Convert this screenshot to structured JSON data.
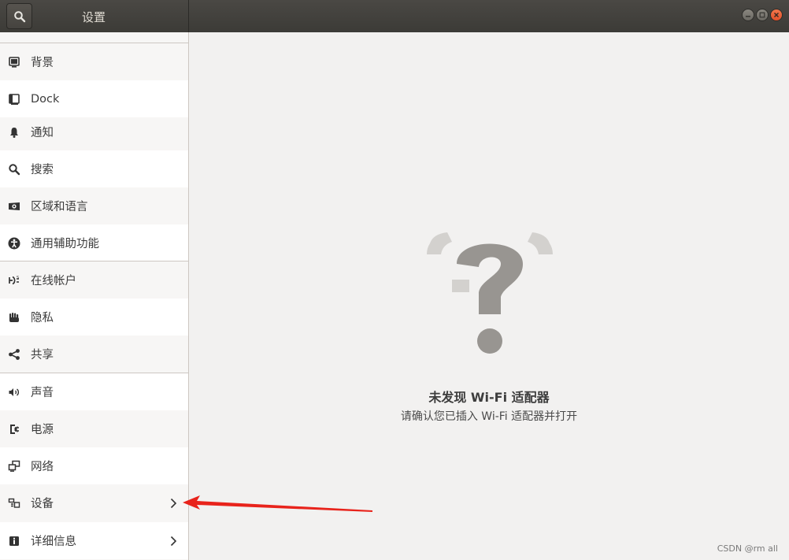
{
  "window": {
    "title": "设置",
    "search_icon": "search-icon",
    "controls": [
      "minimize-icon",
      "maximize-icon",
      "close-icon"
    ]
  },
  "sidebar": {
    "items": [
      {
        "label": "背景",
        "icon": "background-icon"
      },
      {
        "label": "Dock",
        "icon": "dock-icon"
      },
      {
        "label": "通知",
        "icon": "bell-icon"
      },
      {
        "label": "搜索",
        "icon": "search-icon"
      },
      {
        "label": "区域和语言",
        "icon": "region-icon"
      },
      {
        "label": "通用辅助功能",
        "icon": "accessibility-icon"
      },
      {
        "label": "在线帐户",
        "icon": "online-accounts-icon"
      },
      {
        "label": "隐私",
        "icon": "privacy-hand-icon"
      },
      {
        "label": "共享",
        "icon": "share-icon"
      },
      {
        "label": "声音",
        "icon": "speaker-icon"
      },
      {
        "label": "电源",
        "icon": "power-icon"
      },
      {
        "label": "网络",
        "icon": "network-icon"
      },
      {
        "label": "设备",
        "icon": "devices-icon",
        "has_submenu": true
      },
      {
        "label": "详细信息",
        "icon": "info-icon",
        "has_submenu": true
      }
    ]
  },
  "main": {
    "empty_state": {
      "icon": "question-mark-icon",
      "title": "未发现 Wi-Fi 适配器",
      "subtitle": "请确认您已插入 Wi-Fi 适配器并打开"
    }
  },
  "watermark": "CSDN @rm all",
  "colors": {
    "titlebar": "#3c3b37",
    "close_button": "#e2502a",
    "annotation_arrow": "#e8231b"
  }
}
